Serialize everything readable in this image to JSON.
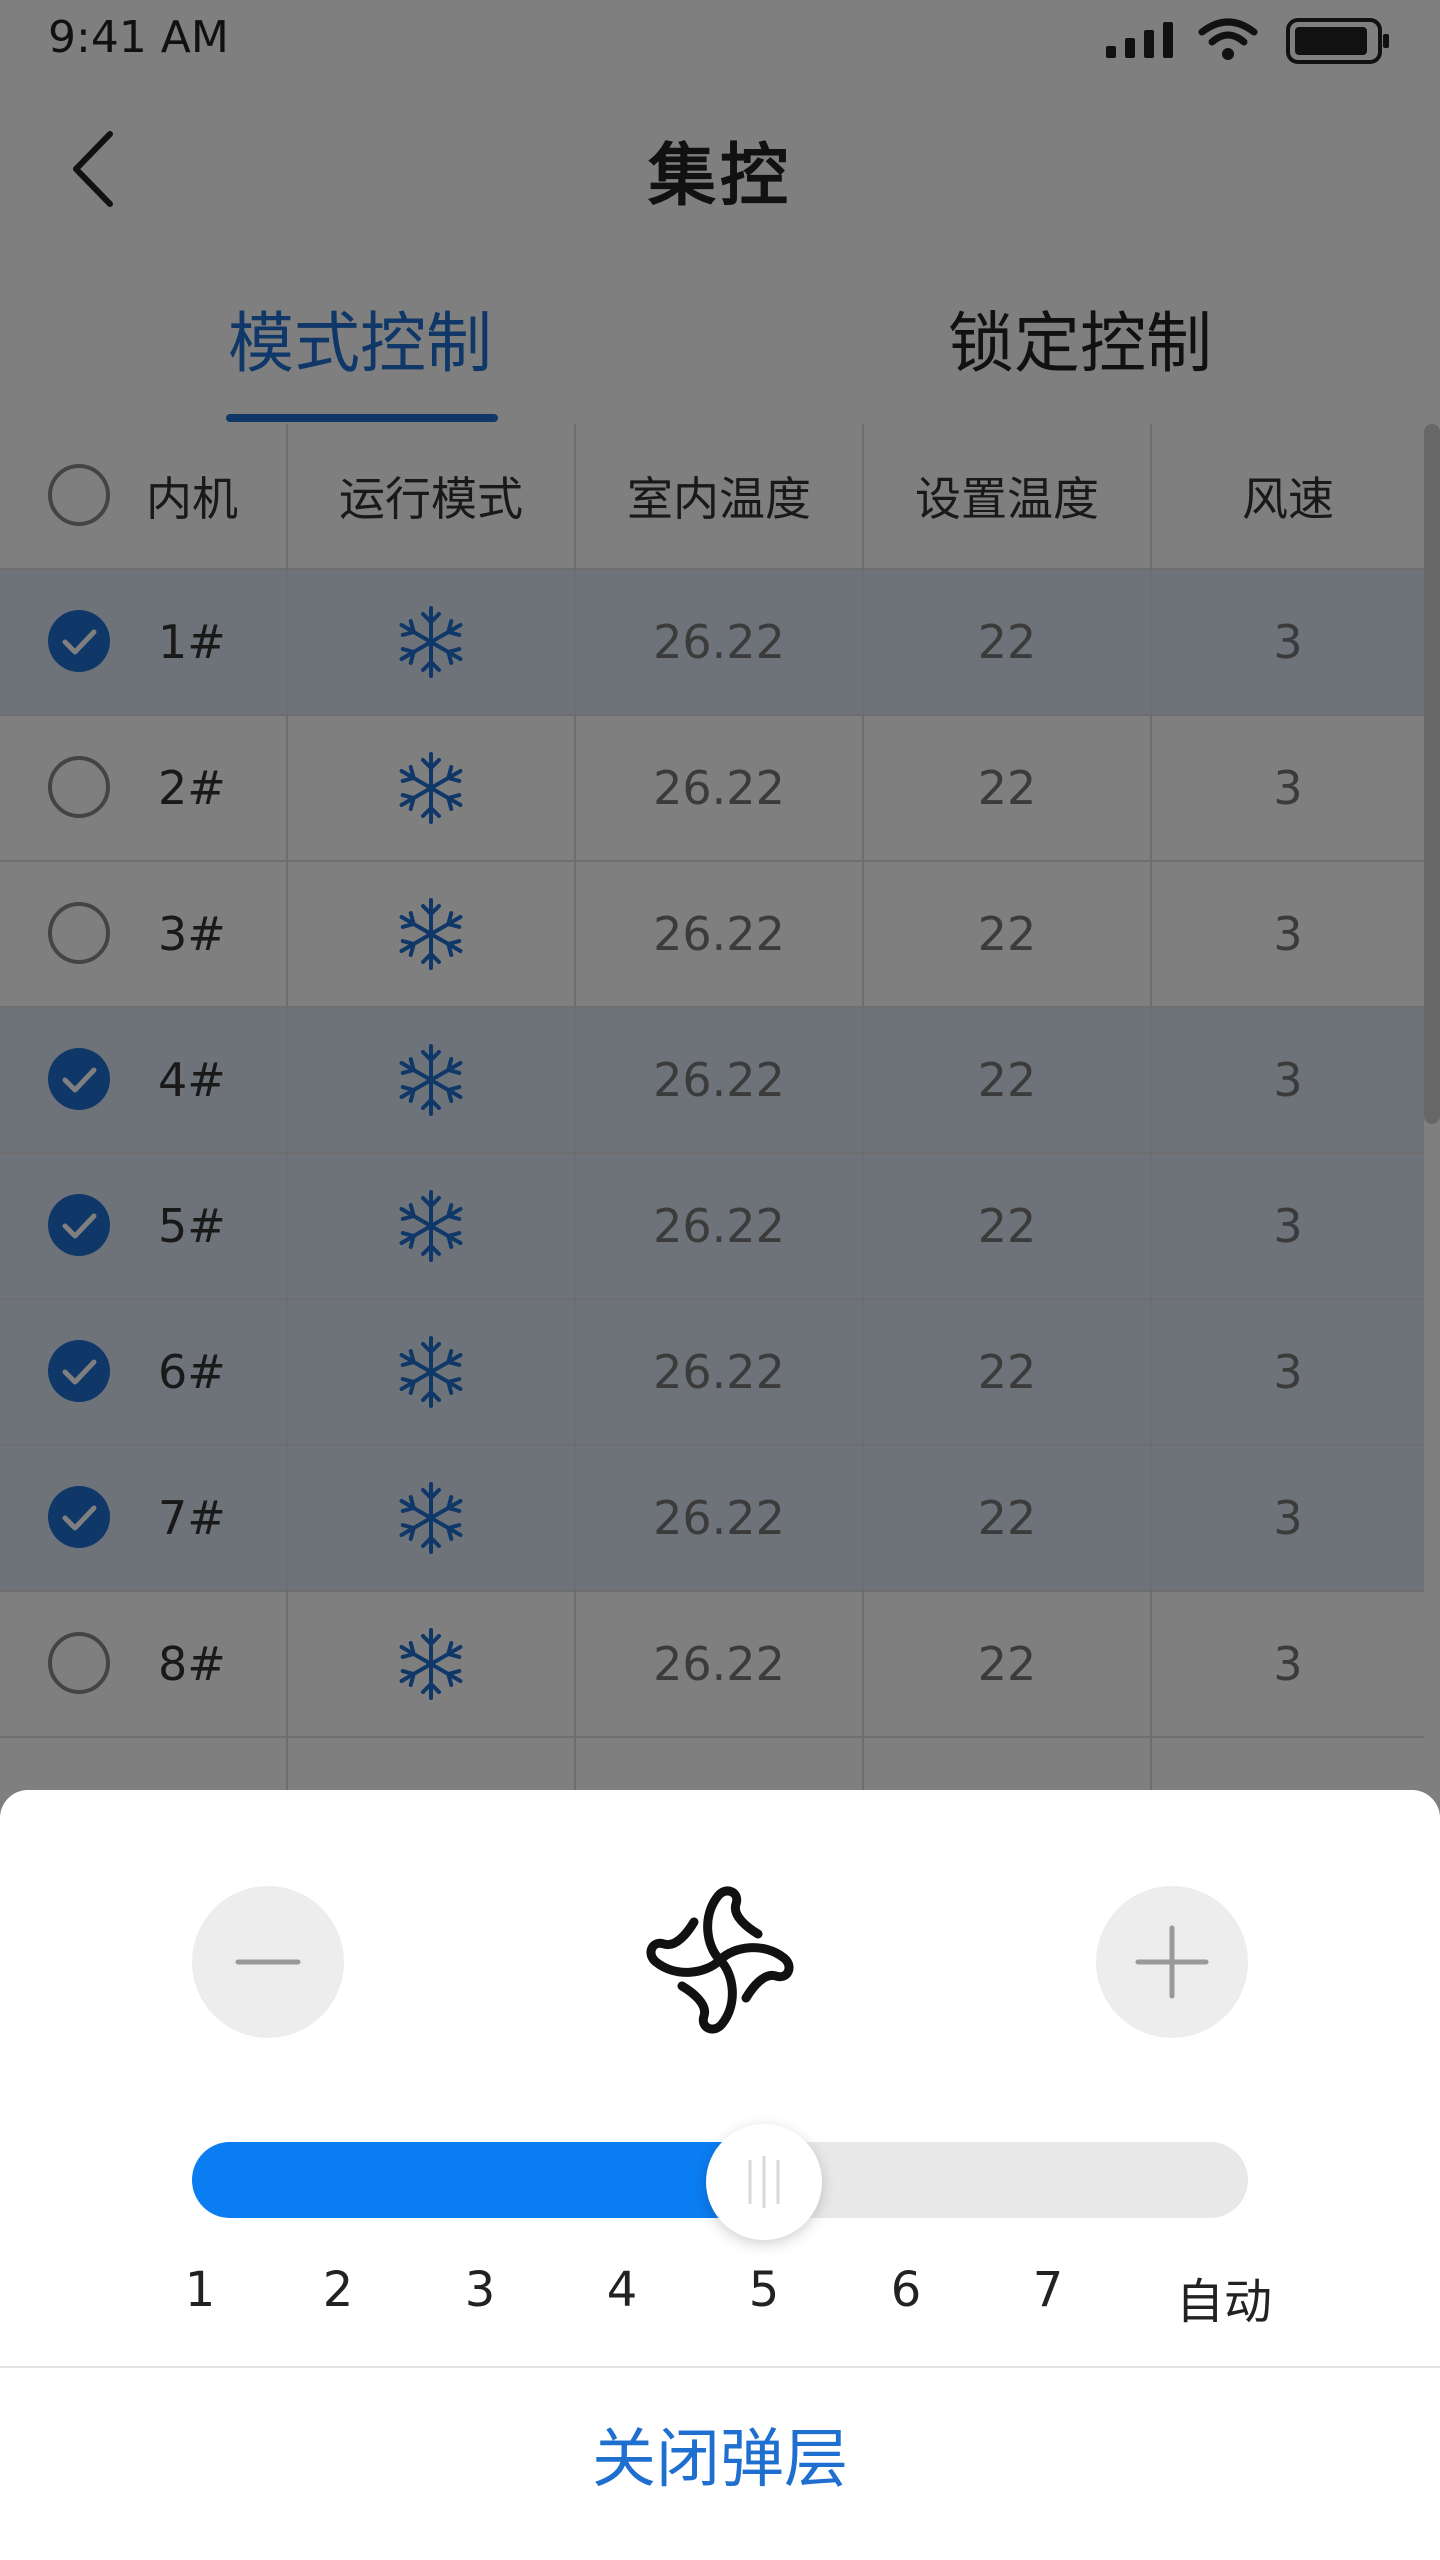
{
  "status": {
    "time": "9:41 AM"
  },
  "nav": {
    "title": "集控"
  },
  "tabs": [
    {
      "label": "模式控制",
      "active": true
    },
    {
      "label": "锁定控制",
      "active": false
    }
  ],
  "table": {
    "headers": [
      "内机",
      "运行模式",
      "室内温度",
      "设置温度",
      "风速"
    ],
    "rows": [
      {
        "unit": "1#",
        "mode": "snowflake-icon",
        "indoor": "26.22",
        "set": "22",
        "fan": "3",
        "checked": true
      },
      {
        "unit": "2#",
        "mode": "snowflake-icon",
        "indoor": "26.22",
        "set": "22",
        "fan": "3",
        "checked": false
      },
      {
        "unit": "3#",
        "mode": "snowflake-icon",
        "indoor": "26.22",
        "set": "22",
        "fan": "3",
        "checked": false
      },
      {
        "unit": "4#",
        "mode": "snowflake-icon",
        "indoor": "26.22",
        "set": "22",
        "fan": "3",
        "checked": true
      },
      {
        "unit": "5#",
        "mode": "snowflake-icon",
        "indoor": "26.22",
        "set": "22",
        "fan": "3",
        "checked": true
      },
      {
        "unit": "6#",
        "mode": "snowflake-icon",
        "indoor": "26.22",
        "set": "22",
        "fan": "3",
        "checked": true
      },
      {
        "unit": "7#",
        "mode": "snowflake-icon",
        "indoor": "26.22",
        "set": "22",
        "fan": "3",
        "checked": true
      },
      {
        "unit": "8#",
        "mode": "snowflake-icon",
        "indoor": "26.22",
        "set": "22",
        "fan": "3",
        "checked": false
      }
    ]
  },
  "sheet": {
    "slider": {
      "ticks": [
        "1",
        "2",
        "3",
        "4",
        "5",
        "6",
        "7",
        "自动"
      ],
      "selected_index": 4
    },
    "close_label": "关闭弹层"
  },
  "colors": {
    "accent": "#1f6fd0",
    "slider_fill": "#0b7df2"
  }
}
